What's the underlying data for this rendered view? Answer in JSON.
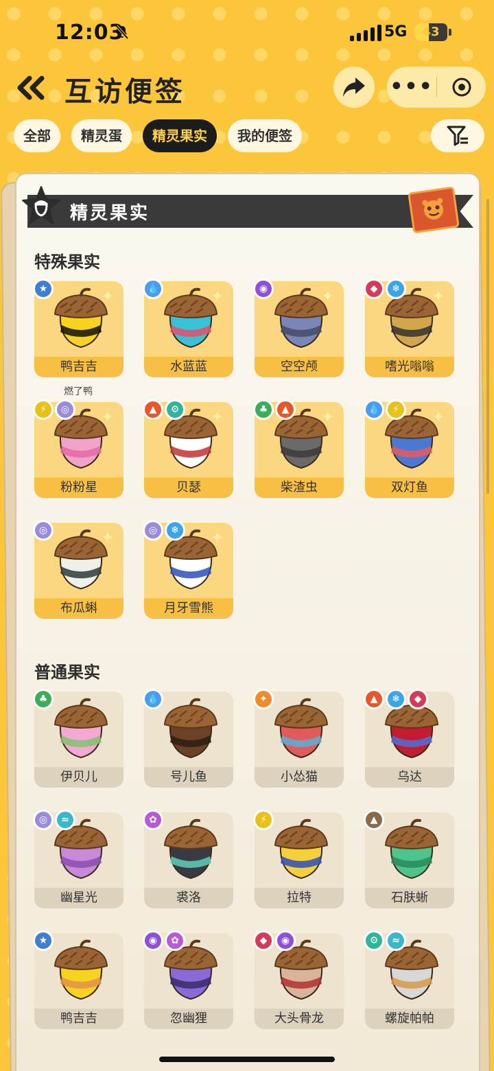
{
  "status": {
    "time": "12:03",
    "network": "5G",
    "battery": "43",
    "battery_level": 0.43
  },
  "header": {
    "title": "互访便签",
    "back_icon": "double-chevron-left-icon"
  },
  "tabs": [
    {
      "label": "全部",
      "active": false
    },
    {
      "label": "精灵蛋",
      "active": false
    },
    {
      "label": "精灵果实",
      "active": true
    },
    {
      "label": "我的便签",
      "active": false
    }
  ],
  "card": {
    "banner_title": "精灵果实"
  },
  "sections": {
    "special": {
      "title": "特殊果实",
      "items": [
        {
          "name": "鸭吉吉",
          "sub": "燃了鸭",
          "badges": [
            "normal"
          ],
          "colors": [
            "#f7d31f",
            "#111111"
          ]
        },
        {
          "name": "水蓝蓝",
          "badges": [
            "water"
          ],
          "colors": [
            "#38c2d8",
            "#e84d68"
          ]
        },
        {
          "name": "空空颅",
          "badges": [
            "ghost"
          ],
          "colors": [
            "#7a86b8",
            "#444a66"
          ]
        },
        {
          "name": "嗜光嗡嗡",
          "badges": [
            "demon",
            "ice"
          ],
          "colors": [
            "#d3a64c",
            "#333333"
          ]
        },
        {
          "name": "粉粉星",
          "badges": [
            "electric",
            "psychic"
          ],
          "colors": [
            "#f0a3c6",
            "#e46aa5"
          ]
        },
        {
          "name": "贝瑟",
          "badges": [
            "fire",
            "mechanical"
          ],
          "colors": [
            "#ffffff",
            "#c23131"
          ]
        },
        {
          "name": "柴渣虫",
          "badges": [
            "grass",
            "fire"
          ],
          "colors": [
            "#6a6a6a",
            "#3b3b3b"
          ]
        },
        {
          "name": "双灯鱼",
          "badges": [
            "water",
            "electric"
          ],
          "colors": [
            "#4a78d6",
            "#e85a5a"
          ]
        },
        {
          "name": "布瓜蝌",
          "badges": [
            "psychic"
          ],
          "colors": [
            "#eef1ea",
            "#2d3b3b"
          ]
        },
        {
          "name": "月牙雪熊",
          "badges": [
            "psychic",
            "ice"
          ],
          "colors": [
            "#ffffff",
            "#2c4fbf"
          ]
        }
      ]
    },
    "normal": {
      "title": "普通果实",
      "items": [
        {
          "name": "伊贝儿",
          "badges": [
            "grass"
          ],
          "colors": [
            "#f4a8d4",
            "#7fc46c"
          ]
        },
        {
          "name": "号儿鱼",
          "badges": [
            "water"
          ],
          "colors": [
            "#6b4226",
            "#2b1d14"
          ]
        },
        {
          "name": "小怂猫",
          "badges": [
            "light"
          ],
          "colors": [
            "#e25a5a",
            "#5bb0d6"
          ]
        },
        {
          "name": "乌达",
          "badges": [
            "fire",
            "ice",
            "demon"
          ],
          "colors": [
            "#c41c2e",
            "#4d6ed8"
          ]
        },
        {
          "name": "幽星光",
          "badges": [
            "psychic",
            "wing"
          ],
          "colors": [
            "#c88ad8",
            "#8a4fb0"
          ]
        },
        {
          "name": "裘洛",
          "badges": [
            "fairy"
          ],
          "colors": [
            "#3a3a44",
            "#5fd0b8"
          ]
        },
        {
          "name": "拉特",
          "badges": [
            "electric"
          ],
          "colors": [
            "#f4d03a",
            "#2c4fbf"
          ]
        },
        {
          "name": "石肤蜥",
          "badges": [
            "ground"
          ],
          "colors": [
            "#4cc48c",
            "#2a8a5c"
          ]
        },
        {
          "name": "鸭吉吉",
          "badges": [
            "normal"
          ],
          "colors": [
            "#f7d31f",
            "#e0904a"
          ]
        },
        {
          "name": "忽幽狸",
          "badges": [
            "ghost",
            "fairy"
          ],
          "colors": [
            "#8a6ad8",
            "#3a2a6a"
          ]
        },
        {
          "name": "大头骨龙",
          "badges": [
            "demon",
            "ghost"
          ],
          "colors": [
            "#d8b49a",
            "#b03030"
          ]
        },
        {
          "name": "螺旋帕帕",
          "badges": [
            "mechanical",
            "wing"
          ],
          "colors": [
            "#d8d8d8",
            "#d89a4a"
          ]
        }
      ]
    }
  },
  "badge_types": {
    "normal": {
      "color": "#3f7fd0",
      "glyph": "★",
      "icon": "star-icon"
    },
    "water": {
      "color": "#4a9cf0",
      "glyph": "💧",
      "icon": "water-drop-icon"
    },
    "ghost": {
      "color": "#8f4fd6",
      "glyph": "◉",
      "icon": "ghost-icon"
    },
    "demon": {
      "color": "#d63a5a",
      "glyph": "◆",
      "icon": "demon-icon"
    },
    "ice": {
      "color": "#3aa6e8",
      "glyph": "❄",
      "icon": "snowflake-icon"
    },
    "electric": {
      "color": "#e8c21a",
      "glyph": "⚡",
      "icon": "lightning-icon"
    },
    "psychic": {
      "color": "#9a8cd8",
      "glyph": "◎",
      "icon": "spiral-icon"
    },
    "fire": {
      "color": "#e8572a",
      "glyph": "▲",
      "icon": "flame-icon"
    },
    "mechanical": {
      "color": "#2fb59a",
      "glyph": "⚙",
      "icon": "gear-icon"
    },
    "grass": {
      "color": "#3cae5a",
      "glyph": "♣",
      "icon": "leaf-icon"
    },
    "light": {
      "color": "#f08a2a",
      "glyph": "✦",
      "icon": "sun-icon"
    },
    "wing": {
      "color": "#3ab8c8",
      "glyph": "≈",
      "icon": "wing-icon"
    },
    "fairy": {
      "color": "#b85ad8",
      "glyph": "✿",
      "icon": "fairy-icon"
    },
    "ground": {
      "color": "#8a6a4a",
      "glyph": "▲",
      "icon": "mountain-icon"
    }
  }
}
